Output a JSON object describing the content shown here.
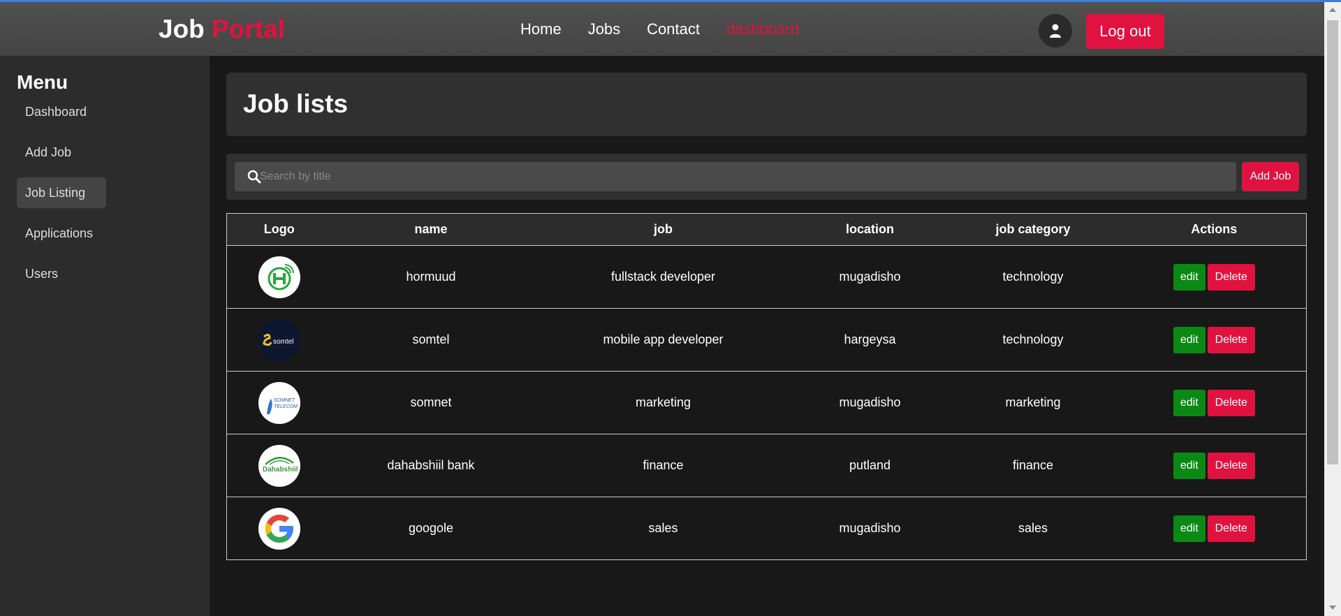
{
  "header": {
    "logo_part1": "Job",
    "logo_part2": "Portal",
    "nav": [
      "Home",
      "Jobs",
      "Contact",
      "dashboard"
    ],
    "logout_label": "Log out"
  },
  "colors": {
    "accent": "#e0123f",
    "edit": "#0a8a14"
  },
  "sidebar": {
    "title": "Menu",
    "items": [
      "Dashboard",
      "Add Job",
      "Job Listing",
      "Applications",
      "Users"
    ],
    "active": "Job Listing"
  },
  "main": {
    "title": "Job lists",
    "search": {
      "placeholder": "Search by title"
    },
    "add_job_label": "Add Job"
  },
  "table": {
    "headers": [
      "Logo",
      "name",
      "job",
      "location",
      "job category",
      "Actions"
    ],
    "rows": [
      {
        "logo_icon": "hormuud-logo",
        "name": "hormuud",
        "job": "fullstack developer",
        "location": "mugadisho",
        "category": "technology"
      },
      {
        "logo_icon": "somtel-logo",
        "logo_text": "somtel",
        "name": "somtel",
        "job": "mobile app developer",
        "location": "hargeysa",
        "category": "technology"
      },
      {
        "logo_icon": "somnet-logo",
        "logo_text": "SOMNET TELECOM",
        "name": "somnet",
        "job": "marketing",
        "location": "mugadisho",
        "category": "marketing"
      },
      {
        "logo_icon": "dahabshiil-logo",
        "logo_text": "Dahabshiil",
        "name": "dahabshiil bank",
        "job": "finance",
        "location": "putland",
        "category": "finance"
      },
      {
        "logo_icon": "google-logo",
        "name": "googole",
        "job": "sales",
        "location": "mugadisho",
        "category": "sales"
      }
    ],
    "edit_label": "edit",
    "delete_label": "Delete"
  }
}
